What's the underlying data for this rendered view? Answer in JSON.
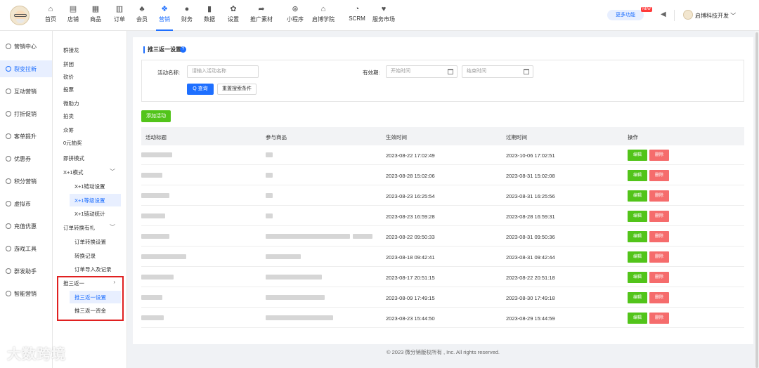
{
  "topnav": {
    "items": [
      {
        "label": "首页",
        "icon": "home-icon",
        "glyph": "⌂"
      },
      {
        "label": "店铺",
        "icon": "store-icon",
        "glyph": "▤"
      },
      {
        "label": "商品",
        "icon": "goods-icon",
        "glyph": "▦"
      },
      {
        "label": "订单",
        "icon": "order-icon",
        "glyph": "▥"
      },
      {
        "label": "会员",
        "icon": "member-icon",
        "glyph": "♣"
      },
      {
        "label": "营销",
        "icon": "marketing-icon",
        "glyph": "❖",
        "active": true
      },
      {
        "label": "财务",
        "icon": "finance-icon",
        "glyph": "●"
      },
      {
        "label": "数据",
        "icon": "data-icon",
        "glyph": "▮"
      },
      {
        "label": "设置",
        "icon": "settings-icon",
        "glyph": "✿"
      },
      {
        "label": "推广素材",
        "icon": "share-icon",
        "glyph": "➦"
      },
      {
        "label": "小程序",
        "icon": "miniapp-icon",
        "glyph": "⊛"
      },
      {
        "label": "启博学院",
        "icon": "academy-icon",
        "glyph": "⌂"
      },
      {
        "label": "SCRM",
        "icon": "scrm-icon",
        "glyph": "◔"
      },
      {
        "label": "服务市场",
        "icon": "market-icon",
        "glyph": "♥"
      }
    ],
    "more_label": "更多功能",
    "new_badge": "NEW",
    "user_name": "启博科技开发"
  },
  "sidebar": {
    "items": [
      {
        "label": "营销中心"
      },
      {
        "label": "裂变拉新",
        "active": true
      },
      {
        "label": "互动营销"
      },
      {
        "label": "打折促销"
      },
      {
        "label": "客单提升"
      },
      {
        "label": "优惠券"
      },
      {
        "label": "积分营销"
      },
      {
        "label": "虚拟币"
      },
      {
        "label": "充值优惠"
      },
      {
        "label": "游戏工具"
      },
      {
        "label": "群发助手"
      },
      {
        "label": "智能营销"
      }
    ]
  },
  "submenu": {
    "items": [
      {
        "label": "群接龙"
      },
      {
        "label": "拼团"
      },
      {
        "label": "砍价"
      },
      {
        "label": "投票"
      },
      {
        "label": "微助力"
      },
      {
        "label": "拍卖"
      },
      {
        "label": "众筹"
      },
      {
        "label": "0元抽奖"
      },
      {
        "label": "即拼模式"
      },
      {
        "label": "X+1模式",
        "chevron": "﹀"
      },
      {
        "label": "X+1链动设置",
        "level": 2
      },
      {
        "label": "X+1等级设置",
        "level": 2,
        "active": true
      },
      {
        "label": "X+1链动统计",
        "level": 2
      },
      {
        "label": "订单转换有礼",
        "chevron": "﹀"
      },
      {
        "label": "订单转换设置",
        "level": 2
      },
      {
        "label": "转换记录",
        "level": 2
      },
      {
        "label": "订单导入及记录",
        "level": 2
      },
      {
        "label": "推三返一",
        "chevron": "›"
      },
      {
        "label": "推三返一设置",
        "level": 2,
        "active": true
      },
      {
        "label": "推三返一资金",
        "level": 2
      }
    ]
  },
  "main": {
    "title": "推三返一设置",
    "help": "?",
    "search": {
      "name_label": "活动名称:",
      "name_placeholder": "请输入活动名称",
      "period_label": "有效期:",
      "start_placeholder": "开始时间",
      "end_placeholder": "结束时间",
      "query_label": "Q 查询",
      "reset_label": "重置搜索条件"
    },
    "add_label": "添加活动",
    "table": {
      "headers": [
        "活动标题",
        "参与商品",
        "生效时间",
        "过期时间",
        "操作"
      ],
      "edit_label": "编辑",
      "delete_label": "删除",
      "rows": [
        {
          "start": "2023-08-22 17:02:49",
          "end": "2023-10-06 17:02:51"
        },
        {
          "start": "2023-08-28 15:02:06",
          "end": "2023-08-31 15:02:08"
        },
        {
          "start": "2023-08-23 16:25:54",
          "end": "2023-08-31 16:25:56"
        },
        {
          "start": "2023-08-23 16:59:28",
          "end": "2023-08-28 16:59:31"
        },
        {
          "start": "2023-08-22 09:50:33",
          "end": "2023-08-31 09:50:36"
        },
        {
          "start": "2023-08-18 09:42:41",
          "end": "2023-08-31 09:42:44"
        },
        {
          "start": "2023-08-17 20:51:15",
          "end": "2023-08-22 20:51:18"
        },
        {
          "start": "2023-08-09 17:49:15",
          "end": "2023-08-30 17:49:18"
        },
        {
          "start": "2023-08-23 15:44:50",
          "end": "2023-08-29 15:44:59"
        }
      ]
    }
  },
  "footer": "© 2023 微分销版权所有 , Inc. All rights reserved.",
  "watermark": "大数跨境",
  "colors": {
    "accent": "#1e6fff",
    "green": "#52c41a",
    "red": "#f56c6c"
  }
}
